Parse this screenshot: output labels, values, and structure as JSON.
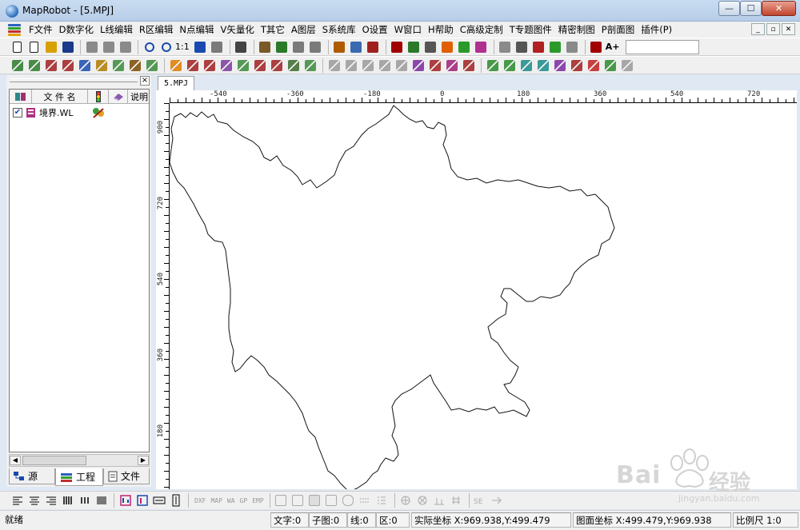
{
  "window": {
    "title": "MapRobot - [5.MPJ]",
    "min_glyph": "—",
    "max_glyph": "☐",
    "close_glyph": "✕"
  },
  "menu": [
    {
      "label": "F文件"
    },
    {
      "label": "D数字化"
    },
    {
      "label": "L线编辑"
    },
    {
      "label": "R区编辑"
    },
    {
      "label": "N点编辑"
    },
    {
      "label": "V矢量化"
    },
    {
      "label": "T其它"
    },
    {
      "label": "A图层"
    },
    {
      "label": "S系统库"
    },
    {
      "label": "O设置"
    },
    {
      "label": "W窗口"
    },
    {
      "label": "H帮助"
    },
    {
      "label": "C高级定制"
    },
    {
      "label": "T专题图件"
    },
    {
      "label": "精密制图"
    },
    {
      "label": "P剖面图"
    },
    {
      "label": "插件(P)"
    }
  ],
  "mdi_buttons": [
    "_",
    "▫",
    "✕"
  ],
  "toolbar": {
    "zoom_ratio_label": "1:1",
    "text_size_label": "A+",
    "row1_colors": [
      "#1a1a1a",
      "#1a1a1a",
      "#d8a000",
      "#1a3a8a",
      "#8a8a8a",
      "#8a8a8a",
      "#8a8a8a",
      "#1a4ab0",
      "#1a4ab0",
      "#1a4ab0",
      "#7a7a7a",
      "#2a7a2a",
      "#444",
      "#7a5a2a",
      "#2a7a2a",
      "#7a7a7a",
      "#7a7a7a",
      "#b05a00",
      "#3a6ab0",
      "#a02020",
      "#a00000",
      "#2a7a2a",
      "#555",
      "#e06000",
      "#2a9a2a",
      "#b03090",
      "#8a8a8a",
      "#b02020"
    ],
    "row2_colors": [
      "#2a7a2a",
      "#2a7a2a",
      "#a02020",
      "#a02020",
      "#1a4ab0",
      "#b07a00",
      "#3a8a3a",
      "#7a4a00",
      "#3a8a3a",
      "#e07a00",
      "#a02020",
      "#a02020",
      "#7a3aa0",
      "#3a8a3a",
      "#a02020",
      "#a02020",
      "#3a6a2a",
      "#3a8a3a",
      "#9a9a9a",
      "#9a9a9a",
      "#9a9a9a",
      "#9a9a9a",
      "#9a9a9a",
      "#7a2aa0",
      "#a02020",
      "#a0207a",
      "#a02020",
      "#2a8a2a",
      "#2a8a2a",
      "#1a8a8a",
      "#1a8a8a",
      "#7a2aa0",
      "#a02020",
      "#c02020",
      "#2a8a2a",
      "#9a9a9a",
      "#9a9a9a",
      "#9a9a9a",
      "#9a9a9a",
      "#9a9a9a"
    ]
  },
  "left_panel": {
    "col_file_name": "文 件 名",
    "col_desc": "说明",
    "file_row": {
      "name": "境界.WL",
      "checked": "✔"
    },
    "tabs": [
      {
        "label": "源"
      },
      {
        "label": "工程"
      },
      {
        "label": "文件"
      }
    ],
    "scroll_left": "◀",
    "scroll_right": "▶"
  },
  "document_tab": "5.MPJ",
  "rulers": {
    "top_labels": [
      "-540",
      "-360",
      "-180",
      "0",
      "180",
      "360",
      "540",
      "720"
    ],
    "left_labels": [
      "900",
      "720",
      "540",
      "360",
      "180"
    ]
  },
  "bottom_toolbar": {
    "text_buttons": [
      "DXF",
      "MAP",
      "WA",
      "GP",
      "EMP"
    ]
  },
  "status": {
    "ready": "就绪",
    "text_count": "文字:0",
    "sub_count": "子图:0",
    "line_count": "线:0",
    "area_count": "区:0",
    "real_coords": "实际坐标 X:969.938,Y:499.479",
    "map_coords": "图面坐标 X:499.479,Y:969.938",
    "scale": "比例尺 1:0"
  },
  "watermark": {
    "brand": "Bai",
    "brand_suffix": "经验",
    "url": "jingyan.baidu.com"
  }
}
